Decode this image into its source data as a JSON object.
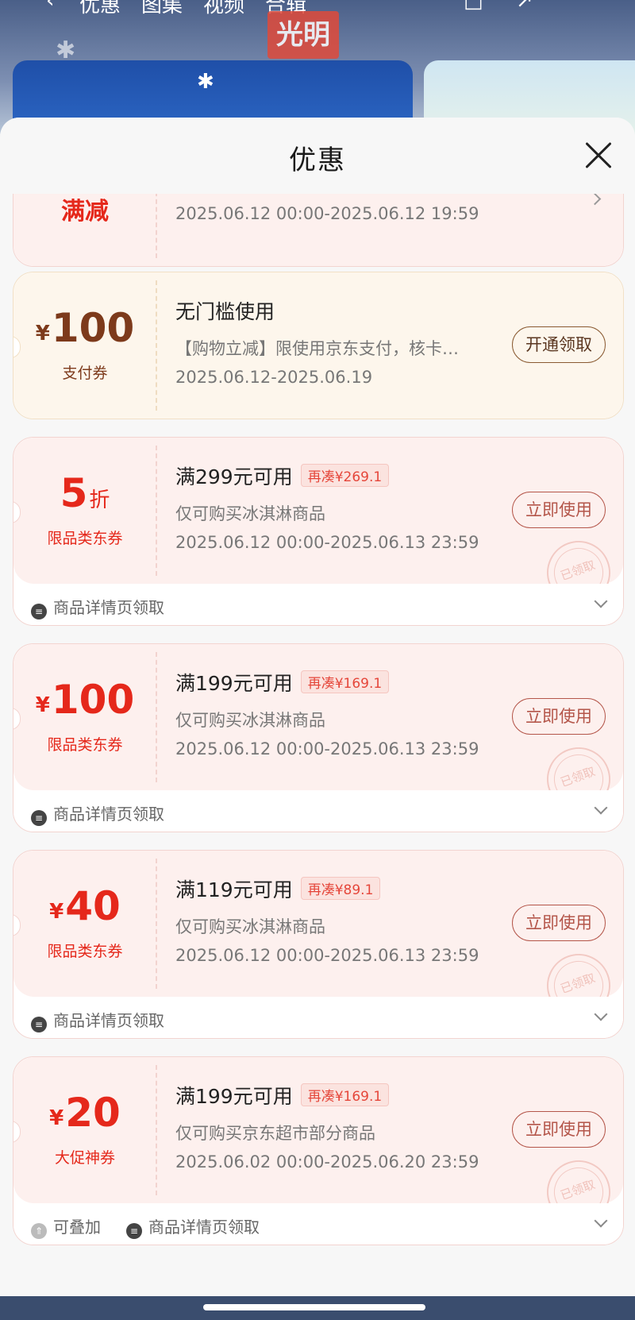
{
  "background": {
    "tabs": [
      "优惠",
      "图集",
      "视频",
      "合辑"
    ],
    "brand": "光明"
  },
  "sheet": {
    "title": "优惠"
  },
  "coupons": [
    {
      "amount_text": "满减",
      "date": "2025.06.12 00:00-2025.06.12 19:59"
    },
    {
      "currency": "¥",
      "amount": "100",
      "label": "支付券",
      "condition": "无门槛使用",
      "description": "【购物立减】限使用京东支付，核卡…",
      "date": "2025.06.12-2025.06.19",
      "button": "开通领取"
    },
    {
      "amount": "5",
      "unit": "折",
      "label": "限品类东券",
      "condition": "满299元可用",
      "tag": "再凑¥269.1",
      "description": "仅可购买冰淇淋商品",
      "date": "2025.06.12 00:00-2025.06.13 23:59",
      "button": "立即使用",
      "stamp": "已领取",
      "footer": "商品详情页领取"
    },
    {
      "currency": "¥",
      "amount": "100",
      "label": "限品类东券",
      "condition": "满199元可用",
      "tag": "再凑¥169.1",
      "description": "仅可购买冰淇淋商品",
      "date": "2025.06.12 00:00-2025.06.13 23:59",
      "button": "立即使用",
      "stamp": "已领取",
      "footer": "商品详情页领取"
    },
    {
      "currency": "¥",
      "amount": "40",
      "label": "限品类东券",
      "condition": "满119元可用",
      "tag": "再凑¥89.1",
      "description": "仅可购买冰淇淋商品",
      "date": "2025.06.12 00:00-2025.06.13 23:59",
      "button": "立即使用",
      "stamp": "已领取",
      "footer": "商品详情页领取"
    },
    {
      "currency": "¥",
      "amount": "20",
      "label": "大促神券",
      "condition": "满199元可用",
      "tag": "再凑¥169.1",
      "description": "仅可购买京东超市部分商品",
      "date": "2025.06.02 00:00-2025.06.20 23:59",
      "button": "立即使用",
      "stamp": "已领取",
      "footer_stack": "可叠加",
      "footer": "商品详情页领取"
    }
  ],
  "colors": {
    "accent_red": "#e5281b",
    "gold_brown": "#7d3a1b",
    "card_pink": "#fdf0ee",
    "card_cream": "#fdf6ec"
  }
}
